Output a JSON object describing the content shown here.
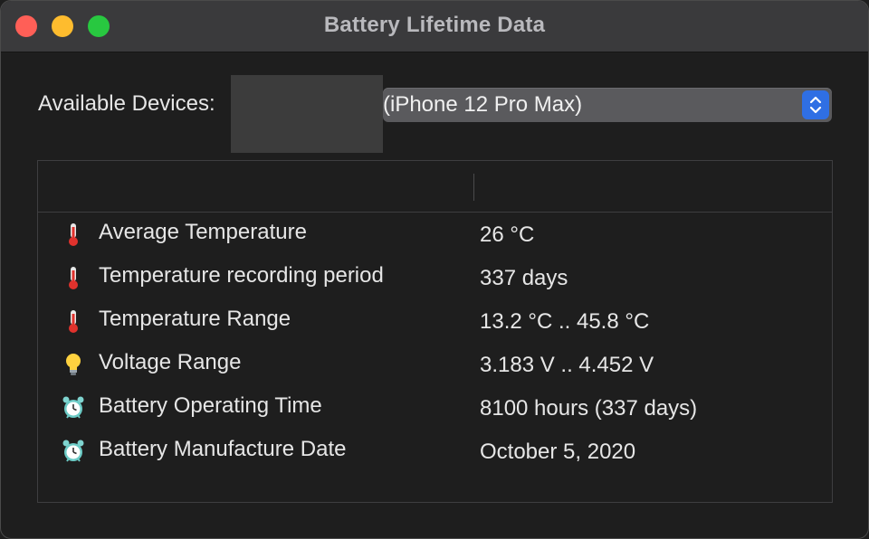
{
  "window": {
    "title": "Battery Lifetime Data"
  },
  "device_selector": {
    "label": "Available Devices:",
    "selected": "(iPhone 12 Pro Max)"
  },
  "table": {
    "columns": [
      "",
      ""
    ],
    "rows": [
      {
        "icon": "thermometer-icon",
        "label": "Average Temperature",
        "value": "26 °C"
      },
      {
        "icon": "thermometer-icon",
        "label": "Temperature recording period",
        "value": "337 days"
      },
      {
        "icon": "thermometer-icon",
        "label": "Temperature Range",
        "value": "13.2 °C .. 45.8 °C"
      },
      {
        "icon": "light-bulb-icon",
        "label": "Voltage Range",
        "value": "3.183 V .. 4.452 V"
      },
      {
        "icon": "alarm-clock-icon",
        "label": "Battery Operating Time",
        "value": "8100 hours (337 days)"
      },
      {
        "icon": "alarm-clock-icon",
        "label": "Battery Manufacture Date",
        "value": "October 5, 2020"
      }
    ]
  },
  "colors": {
    "background": "#1e1e1e",
    "titlebar": "#3a3a3c",
    "accent": "#2f6fe4",
    "close": "#ff5f57",
    "minimize": "#febc2e",
    "zoom": "#28c840"
  }
}
